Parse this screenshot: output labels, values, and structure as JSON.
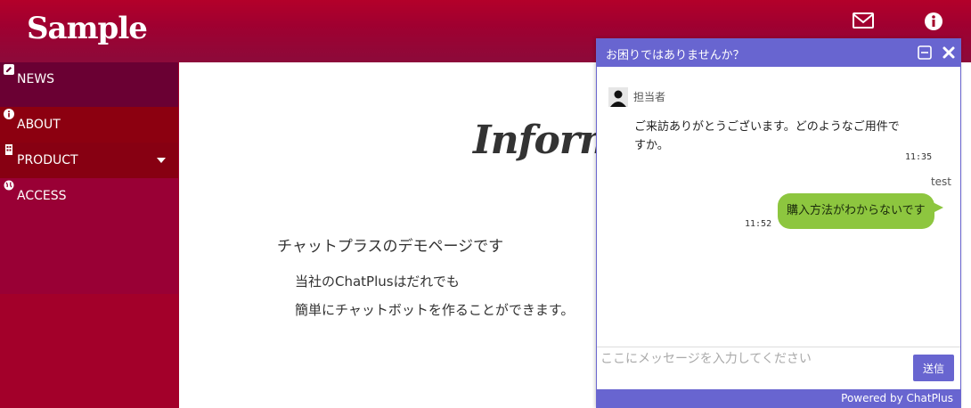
{
  "header": {
    "logo": "Sample",
    "icons": [
      "mail-icon",
      "info-icon"
    ]
  },
  "sidebar": {
    "items": [
      {
        "label": "NEWS",
        "icon": "pencil-icon"
      },
      {
        "label": "ABOUT",
        "icon": "info-icon"
      },
      {
        "label": "PRODUCT",
        "icon": "building-icon"
      },
      {
        "label": "ACCESS",
        "icon": "globe-icon"
      }
    ]
  },
  "main": {
    "title": "Informa",
    "heading": "チャットプラスのデモページです",
    "lines": [
      "当社のChatPlusはだれでも",
      "簡単にチャットボットを作ることができます。"
    ]
  },
  "chat": {
    "title": "お困りではありませんか？",
    "agent_name": "担当者",
    "agent_message": "ご来訪ありがとうございます。どのようなご用件ですか。",
    "agent_time": "11:35",
    "user_name": "test",
    "user_message": "購入方法がわからないです",
    "user_time": "11:52",
    "input_placeholder": "ここにメッセージを入力してください",
    "send_label": "送信",
    "footer": "Powered by ChatPlus"
  },
  "colors": {
    "brand": "#a3002a",
    "chat_accent": "#6865d0",
    "user_bubble": "#8dc63f"
  }
}
